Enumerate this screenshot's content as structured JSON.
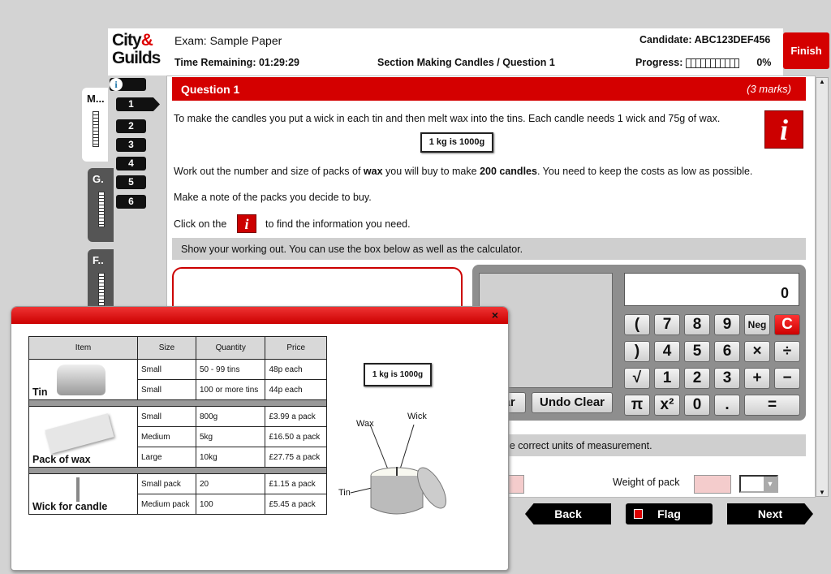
{
  "header": {
    "logo": {
      "line1": "City",
      "amp": "&",
      "line2": "Guilds"
    },
    "exam_title": "Exam: Sample Paper",
    "time_remaining": "Time Remaining: 01:29:29",
    "section": "Section Making Candles / Question 1",
    "candidate": "Candidate: ABC123DEF456",
    "progress_label": "Progress:",
    "progress_percent": "0%",
    "finish_label": "Finish"
  },
  "side_tabs": [
    {
      "label": "M..."
    },
    {
      "label": "G."
    },
    {
      "label": "F.."
    }
  ],
  "question_nav": [
    "1",
    "2",
    "3",
    "4",
    "5",
    "6"
  ],
  "question": {
    "title": "Question 1",
    "marks": "(3 marks)",
    "line1": "To make the candles you put a wick in each tin and then melt wax into the tins. Each candle needs 1 wick and 75g of wax.",
    "kg_note": "1 kg is 1000g",
    "line2_a": "Work out the number and size of packs of ",
    "line2_b": "wax",
    "line2_c": " you will buy to make ",
    "line2_d": "200 candles",
    "line2_e": ". You need to keep the costs as low as possible.",
    "line3": "Make a note of the packs you decide to buy.",
    "line4_a": "Click on the",
    "line4_b": "to find the information you need.",
    "info_glyph": "i",
    "working_hint": "Show your working out. You can use the box below as well as the calculator.",
    "units_hint": "d the correct units of measurement.",
    "weight_label": "Weight of pack"
  },
  "calculator": {
    "display": "0",
    "clear": "Clear",
    "undo_clear": "Undo Clear",
    "keys": [
      "(",
      "7",
      "8",
      "9",
      "Neg",
      "C",
      ")",
      "4",
      "5",
      "6",
      "×",
      "÷",
      "√",
      "1",
      "2",
      "3",
      "+",
      "−",
      "π",
      "x²",
      "0",
      ".",
      "="
    ]
  },
  "nav": {
    "back": "Back",
    "flag": "Flag",
    "next": "Next"
  },
  "popup": {
    "close": "×",
    "kg_note": "1 kg is 1000g",
    "headers": [
      "Item",
      "Size",
      "Quantity",
      "Price"
    ],
    "tin": {
      "label": "Tin",
      "rows": [
        [
          "Small",
          "50 - 99 tins",
          "48p each"
        ],
        [
          "Small",
          "100 or more tins",
          "44p each"
        ]
      ]
    },
    "wax": {
      "label": "Pack of wax",
      "rows": [
        [
          "Small",
          "800g",
          "£3.99 a pack"
        ],
        [
          "Medium",
          "5kg",
          "£16.50 a pack"
        ],
        [
          "Large",
          "10kg",
          "£27.75 a pack"
        ]
      ]
    },
    "wick": {
      "label": "Wick for candle",
      "rows": [
        [
          "Small pack",
          "20",
          "£1.15 a pack"
        ],
        [
          "Medium pack",
          "100",
          "£5.45 a pack"
        ]
      ]
    },
    "diagram": {
      "wax": "Wax",
      "wick": "Wick",
      "tin": "Tin"
    }
  },
  "colors": {
    "accent": "#d40000",
    "calc_body": "#8e8e8e",
    "input_pink": "#f4cccc"
  }
}
